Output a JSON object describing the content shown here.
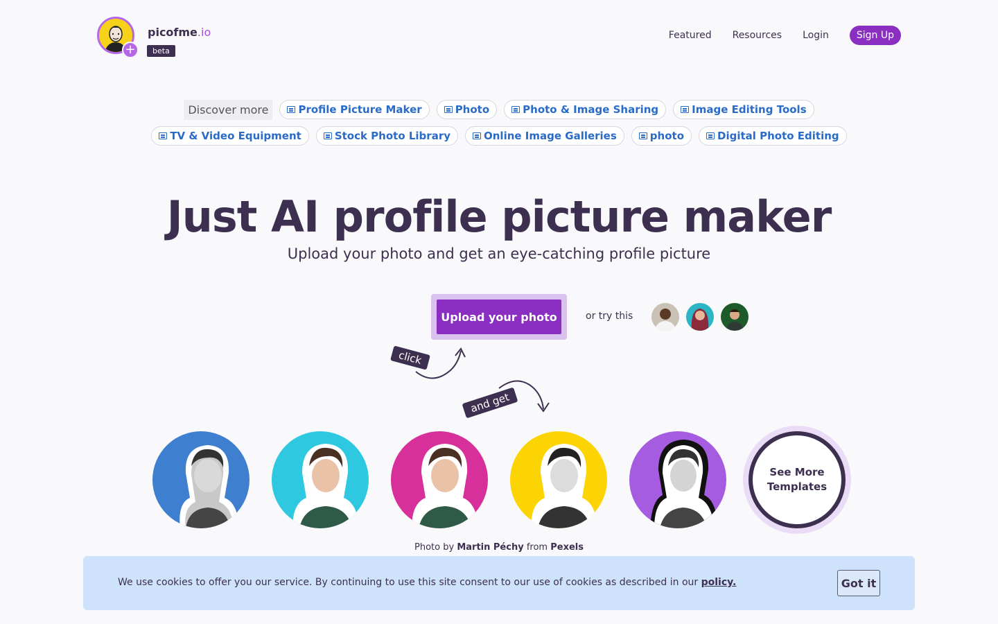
{
  "header": {
    "brand_name": "picofme",
    "brand_tld": ".io",
    "beta_label": "beta",
    "nav": {
      "featured": "Featured",
      "resources": "Resources",
      "login": "Login",
      "signup": "Sign Up"
    }
  },
  "discover": {
    "label": "Discover more",
    "row1": [
      "Profile Picture Maker",
      "Photo",
      "Photo & Image Sharing",
      "Image Editing Tools"
    ],
    "row2": [
      "TV & Video Equipment",
      "Stock Photo Library",
      "Online Image Galleries",
      "photo",
      "Digital Photo Editing"
    ]
  },
  "hero": {
    "title": "Just AI profile picture maker",
    "subtitle": "Upload your photo and get an eye-catching profile picture"
  },
  "upload": {
    "button_label": "Upload your photo",
    "try_text": "or try this"
  },
  "annotations": {
    "click": "click",
    "and_get": "and get"
  },
  "templates": {
    "colors": [
      "#3f7fd0",
      "#2ec8e0",
      "#d8309a",
      "#fcd303",
      "#a55ce0"
    ],
    "see_more": "See More Templates"
  },
  "credit": {
    "prefix": "Photo by",
    "author": "Martin Péchy",
    "middle": "from",
    "source": "Pexels"
  },
  "cookie": {
    "text": "We use cookies to offer you our service. By continuing to use this site consent to our use of cookies as described in our",
    "link": "policy.",
    "button": "Got it"
  }
}
